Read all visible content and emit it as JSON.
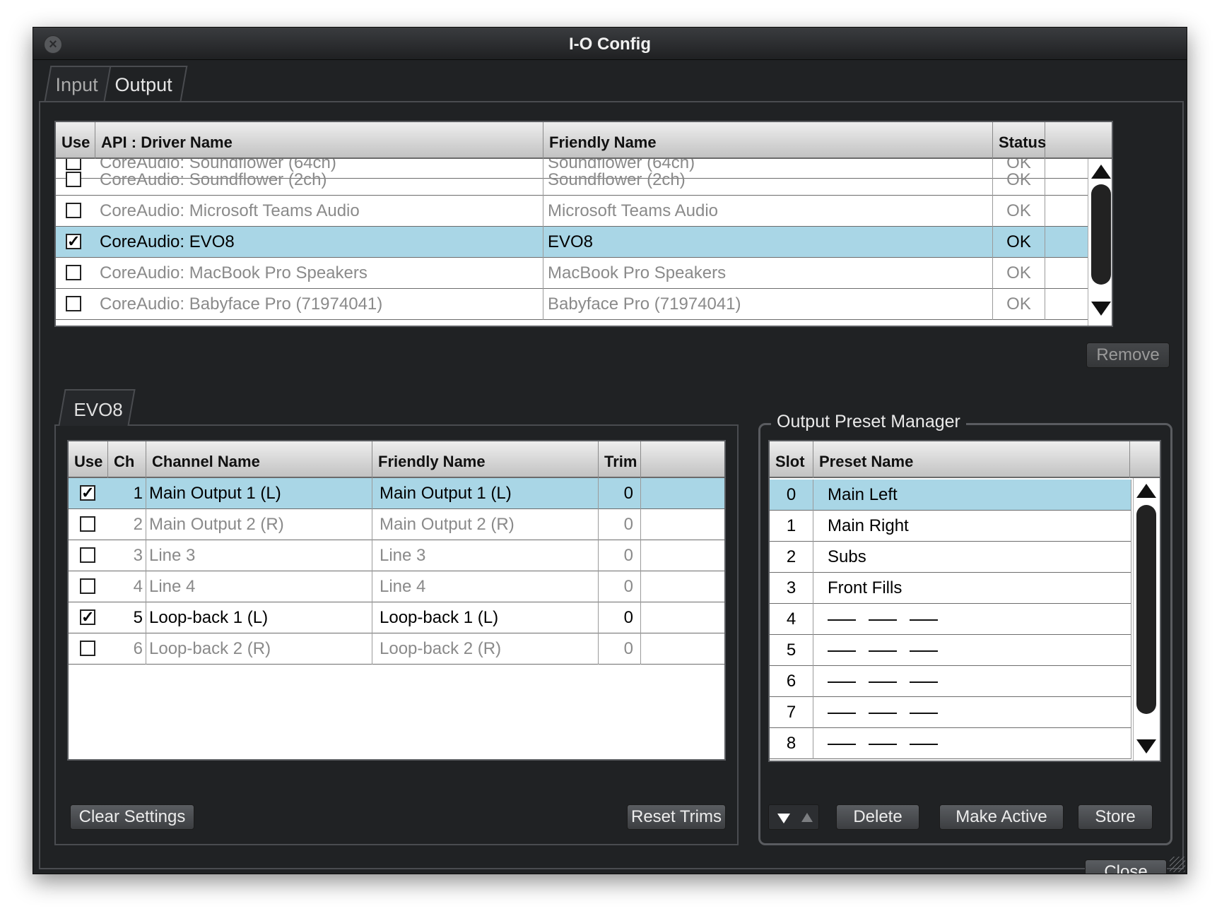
{
  "window": {
    "title": "I-O Config",
    "close_glyph": "×"
  },
  "tabs": [
    {
      "label": "Input"
    },
    {
      "label": "Output"
    }
  ],
  "drivers": {
    "headers": {
      "use": "Use",
      "driver": "API : Driver Name",
      "friendly": "Friendly Name",
      "status": "Status"
    },
    "partial_row": {
      "driver": "CoreAudio: Soundflower (64ch)",
      "friendly": "Soundflower (64ch)",
      "status": "OK"
    },
    "rows": [
      {
        "checked": false,
        "driver": "CoreAudio: Soundflower (2ch)",
        "friendly": "Soundflower (2ch)",
        "status": "OK"
      },
      {
        "checked": false,
        "driver": "CoreAudio: Microsoft Teams Audio",
        "friendly": "Microsoft Teams Audio",
        "status": "OK"
      },
      {
        "checked": true,
        "driver": "CoreAudio: EVO8",
        "friendly": "EVO8",
        "status": "OK"
      },
      {
        "checked": false,
        "driver": "CoreAudio: MacBook Pro Speakers",
        "friendly": "MacBook Pro Speakers",
        "status": "OK"
      },
      {
        "checked": false,
        "driver": "CoreAudio: Babyface Pro (71974041)",
        "friendly": "Babyface Pro (71974041)",
        "status": "OK"
      }
    ],
    "remove_label": "Remove"
  },
  "device": {
    "tab_label": "EVO8",
    "headers": {
      "use": "Use",
      "ch": "Ch",
      "channel": "Channel Name",
      "friendly": "Friendly Name",
      "trim": "Trim"
    },
    "rows": [
      {
        "checked": true,
        "ch": "1",
        "channel": "Main Output 1 (L)",
        "friendly": "Main Output 1 (L)",
        "trim": "0"
      },
      {
        "checked": false,
        "ch": "2",
        "channel": "Main Output 2 (R)",
        "friendly": "Main Output 2 (R)",
        "trim": "0"
      },
      {
        "checked": false,
        "ch": "3",
        "channel": "Line 3",
        "friendly": "Line 3",
        "trim": "0"
      },
      {
        "checked": false,
        "ch": "4",
        "channel": "Line 4",
        "friendly": "Line 4",
        "trim": "0"
      },
      {
        "checked": true,
        "ch": "5",
        "channel": "Loop-back 1 (L)",
        "friendly": "Loop-back 1 (L)",
        "trim": "0"
      },
      {
        "checked": false,
        "ch": "6",
        "channel": "Loop-back 2 (R)",
        "friendly": "Loop-back 2 (R)",
        "trim": "0"
      }
    ],
    "clear_label": "Clear Settings",
    "reset_label": "Reset Trims"
  },
  "presets": {
    "title": "Output Preset Manager",
    "headers": {
      "slot": "Slot",
      "name": "Preset Name"
    },
    "rows": [
      {
        "slot": "0",
        "name": "Main Left"
      },
      {
        "slot": "1",
        "name": "Main Right"
      },
      {
        "slot": "2",
        "name": "Subs"
      },
      {
        "slot": "3",
        "name": "Front Fills"
      },
      {
        "slot": "4",
        "name": ""
      },
      {
        "slot": "5",
        "name": ""
      },
      {
        "slot": "6",
        "name": ""
      },
      {
        "slot": "7",
        "name": ""
      },
      {
        "slot": "8",
        "name": ""
      }
    ],
    "delete_label": "Delete",
    "make_active_label": "Make Active",
    "store_label": "Store"
  },
  "close_label": "Close",
  "colors": {
    "selection": "#a9d6e6",
    "window_bg": "#202224"
  },
  "icons": [
    "close-window-icon",
    "scroll-up-icon",
    "scroll-down-icon",
    "move-down-icon",
    "move-up-icon",
    "resize-grip-icon"
  ]
}
